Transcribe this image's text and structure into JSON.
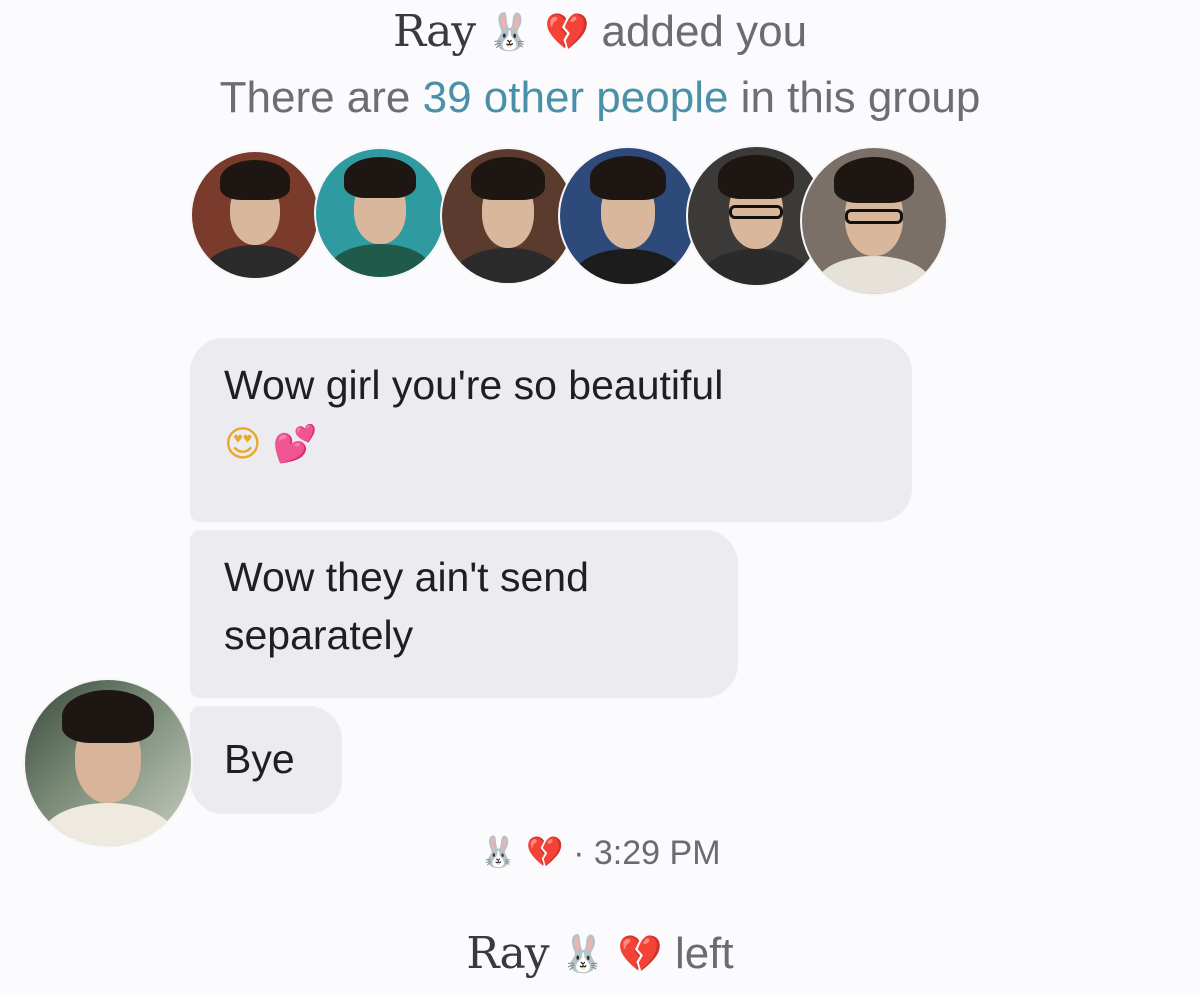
{
  "header": {
    "adder_name": "Ray",
    "adder_emojis": [
      "🐰",
      "💔"
    ],
    "added_text": "added you",
    "count_prefix": "There are",
    "count_link": "39 other people",
    "count_suffix": "in this group"
  },
  "members": [
    {
      "icon": "member-avatar-1",
      "bg": "#7a3a2c"
    },
    {
      "icon": "member-avatar-2",
      "bg": "#2f9aa0"
    },
    {
      "icon": "member-avatar-3",
      "bg": "#5b3b2e"
    },
    {
      "icon": "member-avatar-4",
      "bg": "#2d4a7a"
    },
    {
      "icon": "member-avatar-5",
      "bg": "#3b3a38"
    },
    {
      "icon": "member-avatar-6",
      "bg": "#7a7068"
    }
  ],
  "messages": [
    {
      "line1": "Wow girl you're so beautiful",
      "emojis": [
        "😍",
        "💕"
      ]
    },
    {
      "line1": "Wow they ain't send",
      "line2": "separately"
    },
    {
      "line1": "Bye"
    }
  ],
  "sender": {
    "emojis": [
      "🐰",
      "💔"
    ],
    "separator": "·",
    "time": "3:29 PM"
  },
  "footer": {
    "leaver_name": "Ray",
    "leaver_emojis": [
      "🐰",
      "💔"
    ],
    "left_text": "left"
  }
}
